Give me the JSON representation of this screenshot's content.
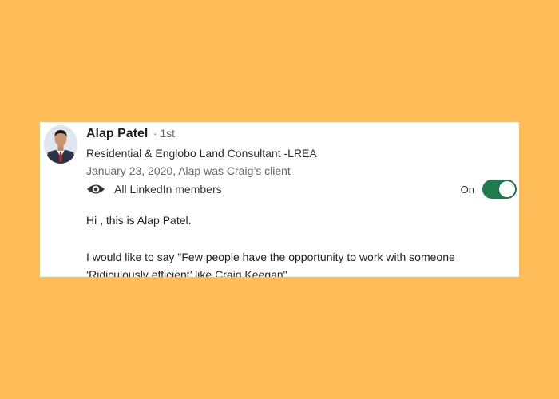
{
  "recommendation": {
    "author_name": "Alap Patel",
    "connection_degree": "· 1st",
    "headline": "Residential & Englobo Land Consultant -LREA",
    "date_relationship": "January 23, 2020, Alap was Craig’s client",
    "visibility_label": "All LinkedIn members",
    "toggle_label": "On",
    "toggle_state": "on",
    "greeting": "Hi , this is Alap Patel.",
    "message_line1": "I would like to say \"Few people have the opportunity to work with someone",
    "message_line2": "‘Ridiculously efficient’ like Craig Keegan\"."
  },
  "colors": {
    "background": "#FFBD59",
    "toggle_on": "#1f7a4d"
  },
  "icons": {
    "visibility": "eye-icon",
    "avatar": "profile-photo"
  }
}
